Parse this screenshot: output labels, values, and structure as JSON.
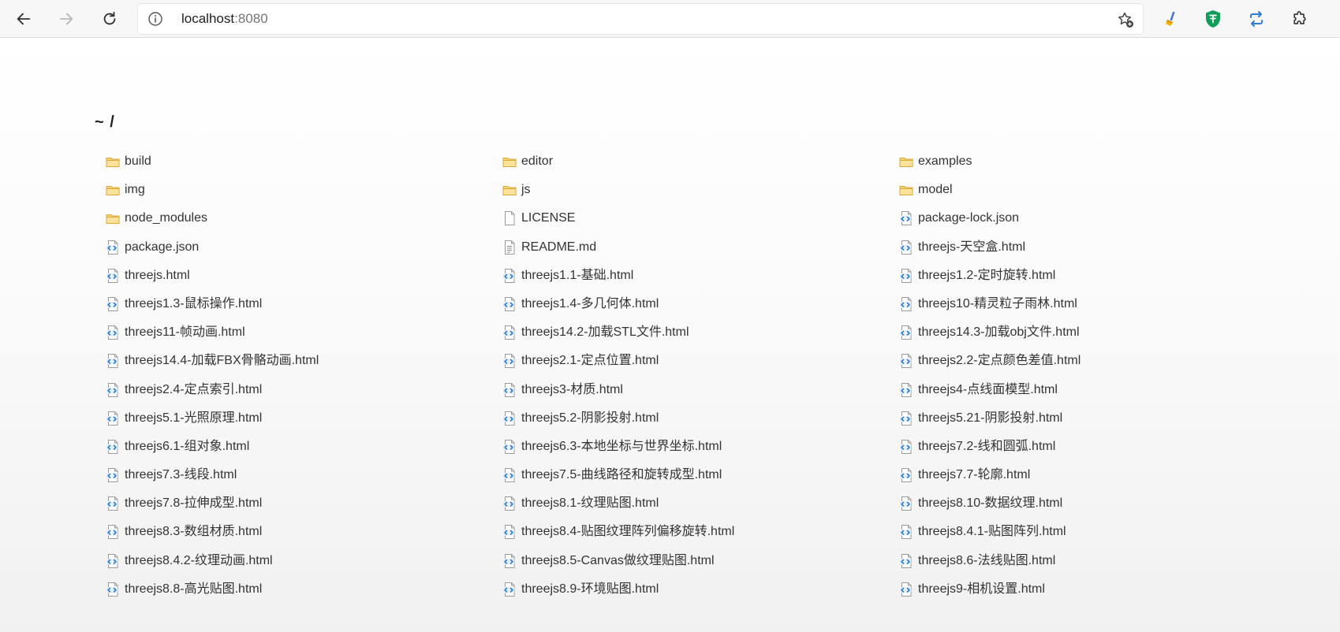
{
  "browser": {
    "url_host": "localhost",
    "url_port": ":8080"
  },
  "page": {
    "breadcrumb": "~ /",
    "files": [
      {
        "name": "build",
        "type": "folder"
      },
      {
        "name": "editor",
        "type": "folder"
      },
      {
        "name": "examples",
        "type": "folder"
      },
      {
        "name": "img",
        "type": "folder"
      },
      {
        "name": "js",
        "type": "folder"
      },
      {
        "name": "model",
        "type": "folder"
      },
      {
        "name": "node_modules",
        "type": "folder"
      },
      {
        "name": "LICENSE",
        "type": "file"
      },
      {
        "name": "package-lock.json",
        "type": "code"
      },
      {
        "name": "package.json",
        "type": "code"
      },
      {
        "name": "README.md",
        "type": "text"
      },
      {
        "name": "threejs-天空盒.html",
        "type": "code"
      },
      {
        "name": "threejs.html",
        "type": "code"
      },
      {
        "name": "threejs1.1-基础.html",
        "type": "code"
      },
      {
        "name": "threejs1.2-定时旋转.html",
        "type": "code"
      },
      {
        "name": "threejs1.3-鼠标操作.html",
        "type": "code"
      },
      {
        "name": "threejs1.4-多几何体.html",
        "type": "code"
      },
      {
        "name": "threejs10-精灵粒子雨林.html",
        "type": "code"
      },
      {
        "name": "threejs11-帧动画.html",
        "type": "code"
      },
      {
        "name": "threejs14.2-加载STL文件.html",
        "type": "code"
      },
      {
        "name": "threejs14.3-加载obj文件.html",
        "type": "code"
      },
      {
        "name": "threejs14.4-加载FBX骨骼动画.html",
        "type": "code"
      },
      {
        "name": "threejs2.1-定点位置.html",
        "type": "code"
      },
      {
        "name": "threejs2.2-定点颜色差值.html",
        "type": "code"
      },
      {
        "name": "threejs2.4-定点索引.html",
        "type": "code"
      },
      {
        "name": "threejs3-材质.html",
        "type": "code"
      },
      {
        "name": "threejs4-点线面模型.html",
        "type": "code"
      },
      {
        "name": "threejs5.1-光照原理.html",
        "type": "code"
      },
      {
        "name": "threejs5.2-阴影投射.html",
        "type": "code"
      },
      {
        "name": "threejs5.21-阴影投射.html",
        "type": "code"
      },
      {
        "name": "threejs6.1-组对象.html",
        "type": "code"
      },
      {
        "name": "threejs6.3-本地坐标与世界坐标.html",
        "type": "code"
      },
      {
        "name": "threejs7.2-线和圆弧.html",
        "type": "code"
      },
      {
        "name": "threejs7.3-线段.html",
        "type": "code"
      },
      {
        "name": "threejs7.5-曲线路径和旋转成型.html",
        "type": "code"
      },
      {
        "name": "threejs7.7-轮廓.html",
        "type": "code"
      },
      {
        "name": "threejs7.8-拉伸成型.html",
        "type": "code"
      },
      {
        "name": "threejs8.1-纹理贴图.html",
        "type": "code"
      },
      {
        "name": "threejs8.10-数据纹理.html",
        "type": "code"
      },
      {
        "name": "threejs8.3-数组材质.html",
        "type": "code"
      },
      {
        "name": "threejs8.4-贴图纹理阵列偏移旋转.html",
        "type": "code"
      },
      {
        "name": "threejs8.4.1-贴图阵列.html",
        "type": "code"
      },
      {
        "name": "threejs8.4.2-纹理动画.html",
        "type": "code"
      },
      {
        "name": "threejs8.5-Canvas做纹理贴图.html",
        "type": "code"
      },
      {
        "name": "threejs8.6-法线贴图.html",
        "type": "code"
      },
      {
        "name": "threejs8.8-高光贴图.html",
        "type": "code"
      },
      {
        "name": "threejs8.9-环境贴图.html",
        "type": "code"
      },
      {
        "name": "threejs9-相机设置.html",
        "type": "code"
      }
    ]
  }
}
